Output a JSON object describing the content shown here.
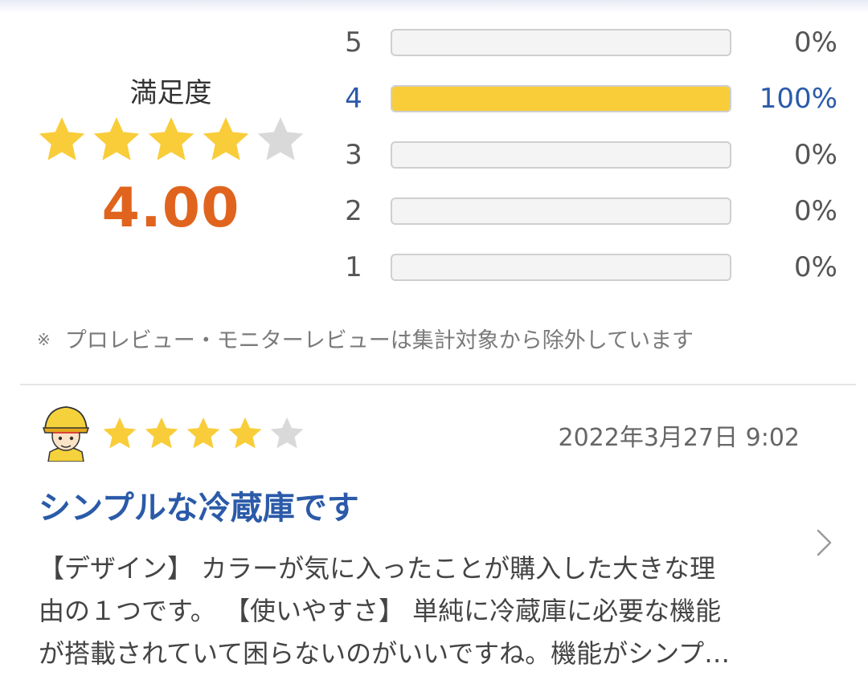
{
  "summary": {
    "label": "満足度",
    "score": "4.00",
    "stars_filled": 4,
    "stars_total": 5,
    "star_color": "#f9cd3a",
    "star_empty_color": "#d9d9d9",
    "score_color": "#e0641e",
    "distribution": [
      {
        "level": "5",
        "percent_label": "0%",
        "fraction": 0
      },
      {
        "level": "4",
        "percent_label": "100%",
        "fraction": 1
      },
      {
        "level": "3",
        "percent_label": "0%",
        "fraction": 0
      },
      {
        "level": "2",
        "percent_label": "0%",
        "fraction": 0
      },
      {
        "level": "1",
        "percent_label": "0%",
        "fraction": 0
      }
    ],
    "note_mark": "※",
    "note": "プロレビュー・モニターレビューは集計対象から除外しています"
  },
  "review": {
    "avatar_icon": "worker-avatar-icon",
    "stars_filled": 4,
    "stars_total": 5,
    "date": "2022年3月27日 9:02",
    "title": "シンプルな冷蔵庫です",
    "title_color": "#2b5aa8",
    "body_lines": [
      "【デザイン】 カラーが気に入ったことが購入した大きな理",
      "由の１つです。 【使いやすさ】 単純に冷蔵庫に必要な機能",
      "が搭載されていて困らないのがいいですね。機能がシンプ…"
    ],
    "chevron_icon": "chevron-right-icon"
  }
}
